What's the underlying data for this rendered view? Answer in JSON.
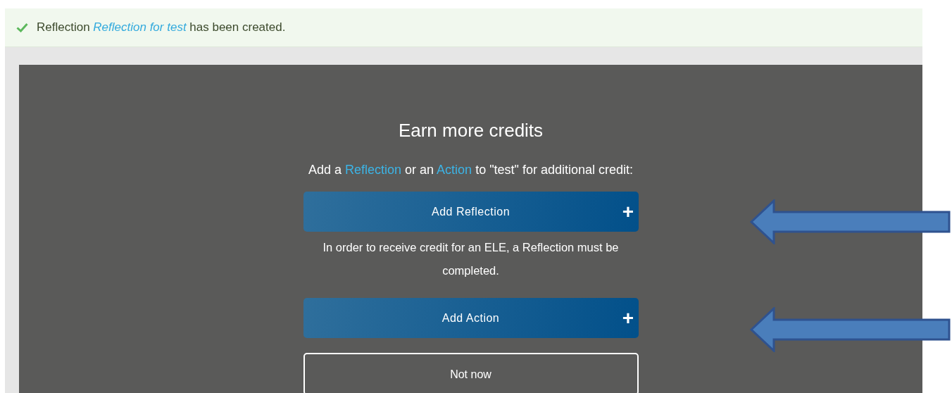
{
  "notice": {
    "prefix": "Reflection",
    "link": "Reflection for test",
    "suffix": "has been created."
  },
  "panel": {
    "title": "Earn more credits",
    "intro": [
      {
        "kind": "text",
        "text": "Add a "
      },
      {
        "kind": "link",
        "text": "Reflection"
      },
      {
        "kind": "text",
        "text": " or an "
      },
      {
        "kind": "link",
        "text": "Action"
      },
      {
        "kind": "text",
        "text": " to \"test\" for additional credit:"
      }
    ],
    "actions": [
      {
        "kind": "primary",
        "label": "Add Reflection",
        "icon": "+"
      },
      {
        "kind": "note",
        "text": "In order to receive credit for an ELE, a Reflection must be completed."
      },
      {
        "kind": "primary",
        "label": "Add Action",
        "icon": "+"
      },
      {
        "kind": "secondary",
        "label": "Not now"
      }
    ]
  }
}
